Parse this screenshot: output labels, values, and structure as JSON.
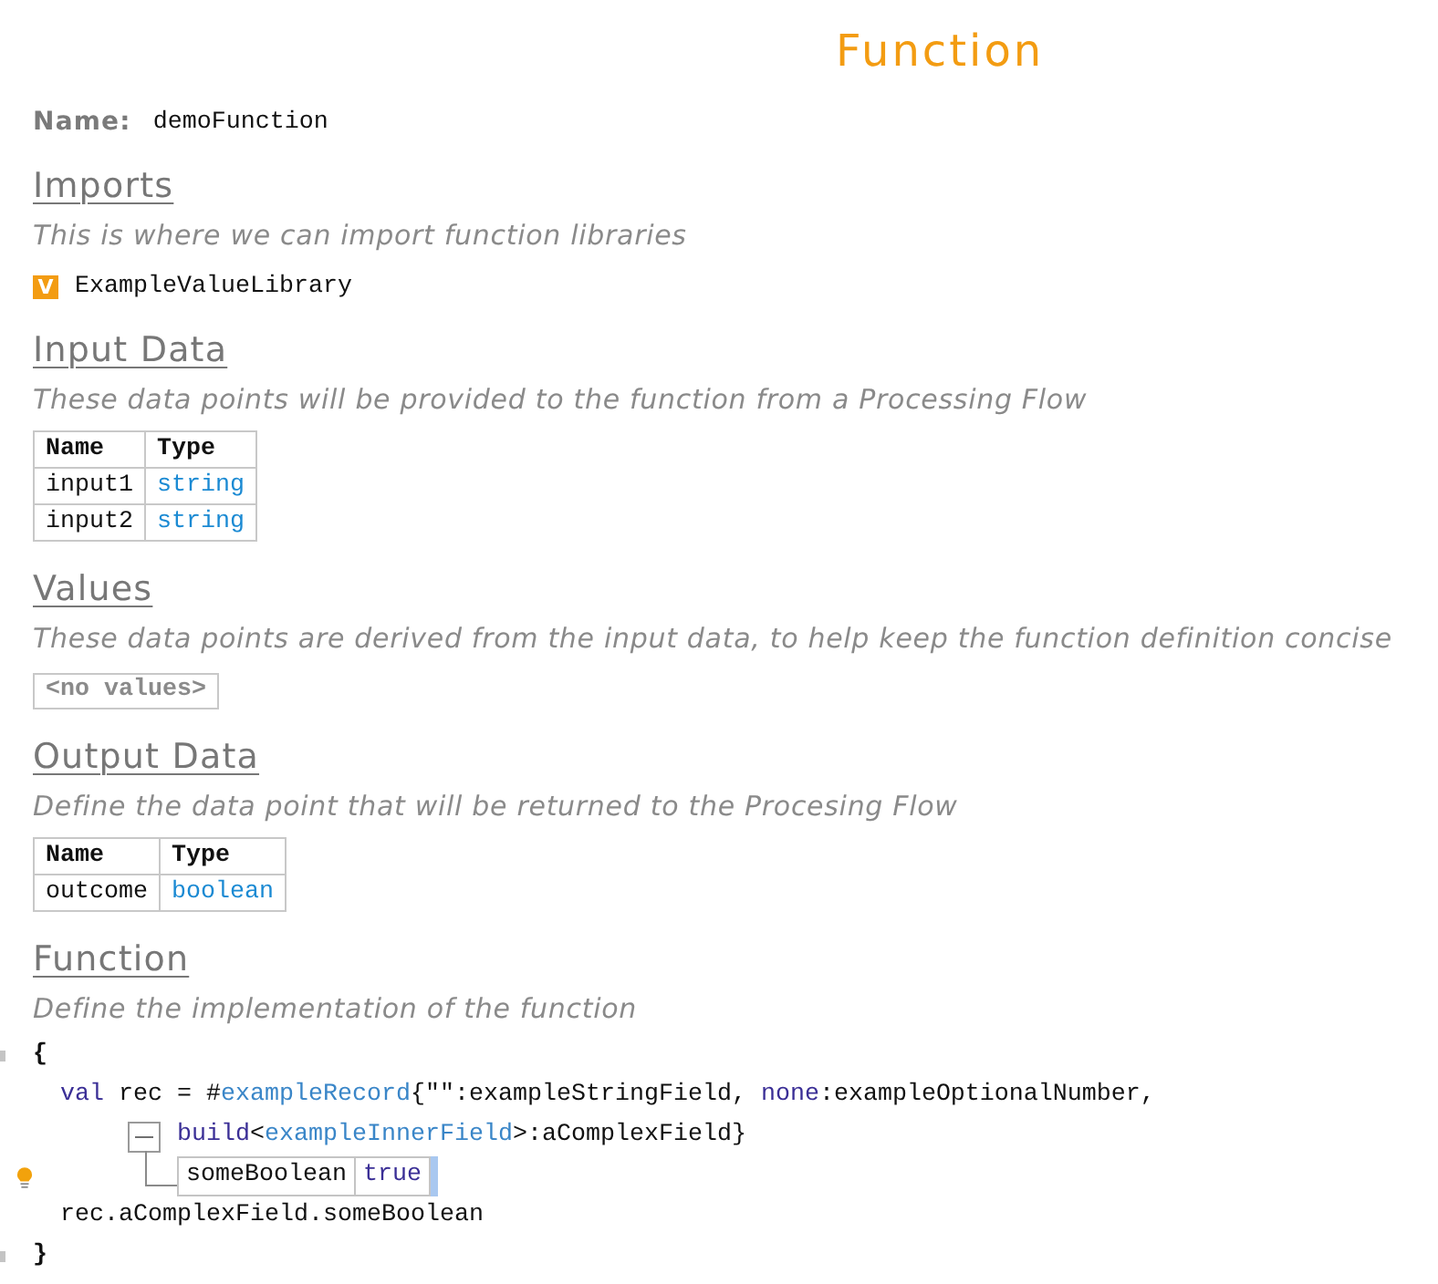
{
  "title": "Function",
  "name": {
    "label": "Name:",
    "value": "demoFunction"
  },
  "sections": [
    {
      "kind": "imports",
      "heading": "Imports",
      "description": "This is where we can import function libraries",
      "items": [
        {
          "badge": "V",
          "label": "ExampleValueLibrary"
        }
      ]
    },
    {
      "kind": "table",
      "heading": "Input Data",
      "description": "These data points will be provided to the function from a Processing Flow",
      "columns": [
        "Name",
        "Type"
      ],
      "rows": [
        {
          "name": "input1",
          "type": "string"
        },
        {
          "name": "input2",
          "type": "string"
        }
      ]
    },
    {
      "kind": "empty",
      "heading": "Values",
      "description": "These data points are derived from the input data, to help keep the function definition concise",
      "empty_text": "<no values>"
    },
    {
      "kind": "table",
      "heading": "Output Data",
      "description": "Define the data point that will be returned to the Procesing Flow",
      "columns": [
        "Name",
        "Type"
      ],
      "rows": [
        {
          "name": "outcome",
          "type": "boolean"
        }
      ]
    },
    {
      "kind": "code",
      "heading": "Function",
      "description": "Define the implementation of the function",
      "code": [
        {
          "kind": "brace",
          "tokens": [
            {
              "kind": "plain",
              "text": "{"
            }
          ]
        },
        {
          "kind": "statement",
          "tokens": [
            {
              "kind": "keyword",
              "text": "val"
            },
            {
              "kind": "plain",
              "text": " rec = #"
            },
            {
              "kind": "reference",
              "text": "exampleRecord"
            },
            {
              "kind": "plain",
              "text": "{\"\":exampleStringField, "
            },
            {
              "kind": "keyword",
              "text": "none"
            },
            {
              "kind": "plain",
              "text": ":exampleOptionalNumber,"
            }
          ]
        },
        {
          "kind": "continuation",
          "expanded": true,
          "tokens": [
            {
              "kind": "keyword",
              "text": "build"
            },
            {
              "kind": "plain",
              "text": "<"
            },
            {
              "kind": "reference",
              "text": "exampleInnerField"
            },
            {
              "kind": "plain",
              "text": ">:aComplexField}"
            }
          ]
        },
        {
          "kind": "field_table",
          "hint": true,
          "cursor": true,
          "cells": [
            {
              "kind": "plain",
              "text": "someBoolean"
            },
            {
              "kind": "keyword",
              "text": "true"
            }
          ]
        },
        {
          "kind": "statement",
          "tokens": [
            {
              "kind": "plain",
              "text": "rec.aComplexField.someBoolean"
            }
          ]
        },
        {
          "kind": "brace",
          "tokens": [
            {
              "kind": "plain",
              "text": "}"
            }
          ]
        }
      ]
    }
  ]
}
